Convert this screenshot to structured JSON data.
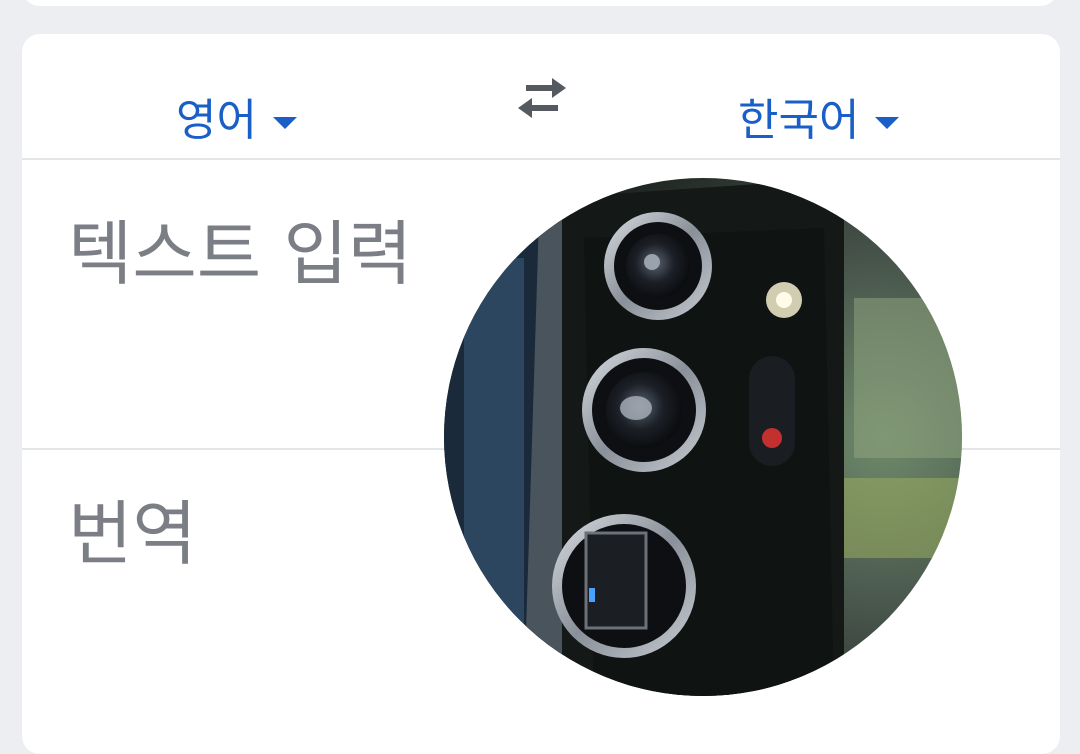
{
  "languages": {
    "source": "영어",
    "target": "한국어"
  },
  "icons": {
    "swap": "swap-arrows-icon",
    "dropdown": "caret-down-icon"
  },
  "input": {
    "placeholder": "텍스트 입력"
  },
  "output": {
    "label": "번역"
  },
  "colors": {
    "accent": "#1a5fc7",
    "placeholder_text": "#7b7e84",
    "background": "#eceef1",
    "card": "#ffffff"
  }
}
